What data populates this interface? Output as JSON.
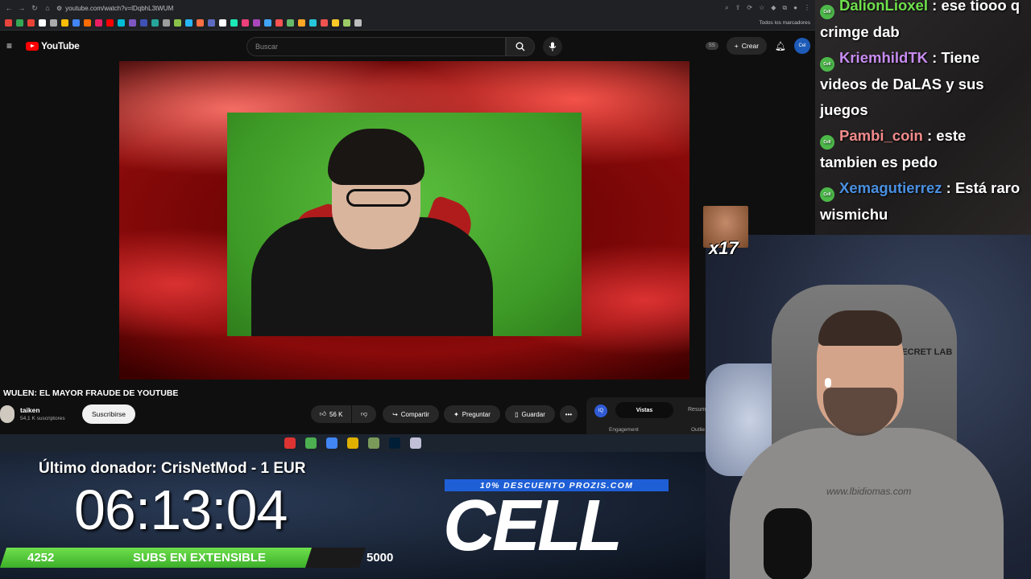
{
  "browser": {
    "url": "youtube.com/watch?v=lDqbhL3tWUM",
    "bookmarks_folder": "Todos los marcadores",
    "bookmark_colors": [
      "#e8453c",
      "#34a853",
      "#ea4335",
      "#ffffff",
      "#aaaaaa",
      "#fbbc05",
      "#4285f4",
      "#ff6d00",
      "#e91e63",
      "#ff0000",
      "#00bcd4",
      "#7e57c2",
      "#3f51b5",
      "#26a69a",
      "#9e9e9e",
      "#8bc34a",
      "#29b6f6",
      "#ff7043",
      "#5c6bc0",
      "#ffffff",
      "#1de9b6",
      "#ec407a",
      "#ab47bc",
      "#42a5f5",
      "#ff5252",
      "#66bb6a",
      "#ffa726",
      "#26c6da",
      "#ef5350",
      "#ffca28",
      "#9ccc65",
      "#bdbdbd"
    ]
  },
  "youtube": {
    "logo_text": "YouTube",
    "search_placeholder": "Buscar",
    "badge": "SS",
    "create_label": "Crear",
    "avatar_text": "Cel",
    "video_title": "WULEN: EL MAYOR FRAUDE DE YOUTUBE",
    "channel_name": "taiken",
    "channel_subs": "54,1 K suscriptores",
    "subscribe_label": "Suscribirse",
    "like_count": "56 K",
    "share_label": "Compartir",
    "ask_label": "Preguntar",
    "save_label": "Guardar",
    "stats": {
      "logo": "IQ",
      "tab_active": "Vistas",
      "tab_2": "Resum",
      "engagement": "Engagement",
      "outlier": "Outlie"
    }
  },
  "taskbar": {
    "icon_colors": [
      "#d33",
      "#4caf50",
      "#4285f4",
      "#e0b000",
      "#7a9a5a",
      "#001e36",
      "#c0c0d8"
    ]
  },
  "overlay": {
    "donor_line": "Último donador: CrisNetMod - 1 EUR",
    "timer": "06:13:04",
    "subs_current": "4252",
    "subs_label": "SUBS EN EXTENSIBLE",
    "subs_goal": "5000",
    "subs_progress": 0.85,
    "promo": "10% DESCUENTO PROZIS.COM",
    "sponsor": "CELL"
  },
  "chat": {
    "badge_text": "Cell",
    "messages": [
      {
        "user": "DalionLioxel",
        "color": "#6ee04c",
        "text": "ese tiooo q crimge dab"
      },
      {
        "user": "KriemhildTK",
        "color": "#c78cf0",
        "text": "Tiene videos de DaLAS y sus juegos"
      },
      {
        "user": "Pambi_coin",
        "color": "#f28b8b",
        "text": "este tambien es pedo"
      },
      {
        "user": "Xemagutierrez",
        "color": "#4a90e2",
        "text": "Está raro wismichu"
      }
    ]
  },
  "emote": {
    "count": "x17"
  },
  "webcam": {
    "chair_text": "SECRET LAB",
    "shirt_text": "www.lbidiomas.com"
  }
}
